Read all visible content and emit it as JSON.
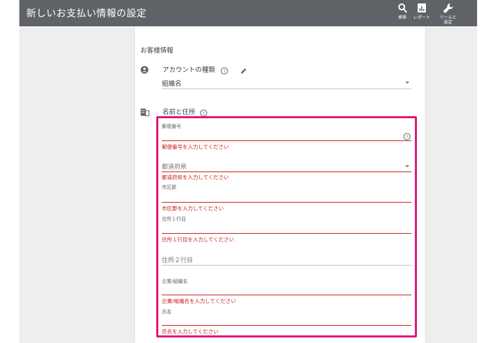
{
  "header": {
    "title": "新しいお支払い情報の設定",
    "search_label": "検索",
    "reports_label": "レポート",
    "tools_label_1": "ツールと",
    "tools_label_2": "設定"
  },
  "customer": {
    "section_title": "お客様情報",
    "account_type_label": "アカウントの種類",
    "account_type_value": "組織名",
    "name_address_label": "名前と住所"
  },
  "fields": {
    "postal_label": "郵便番号",
    "postal_error": "郵便番号を入力してください",
    "prefecture_placeholder": "都道府県",
    "prefecture_error": "都道府県を入力してください",
    "city_label": "市区郡",
    "city_error": "市区郡を入力してください",
    "address1_label": "住所１行目",
    "address1_error": "住所１行目を入力してください",
    "address2_placeholder": "住所２行目",
    "company_label": "企業/組織名",
    "company_error": "企業/組織名を入力してください",
    "name_label": "氏名",
    "name_error": "氏名を入力してください"
  },
  "colors": {
    "topbar": "#5f6368",
    "highlight": "#e0177b",
    "error": "#c5221f"
  }
}
